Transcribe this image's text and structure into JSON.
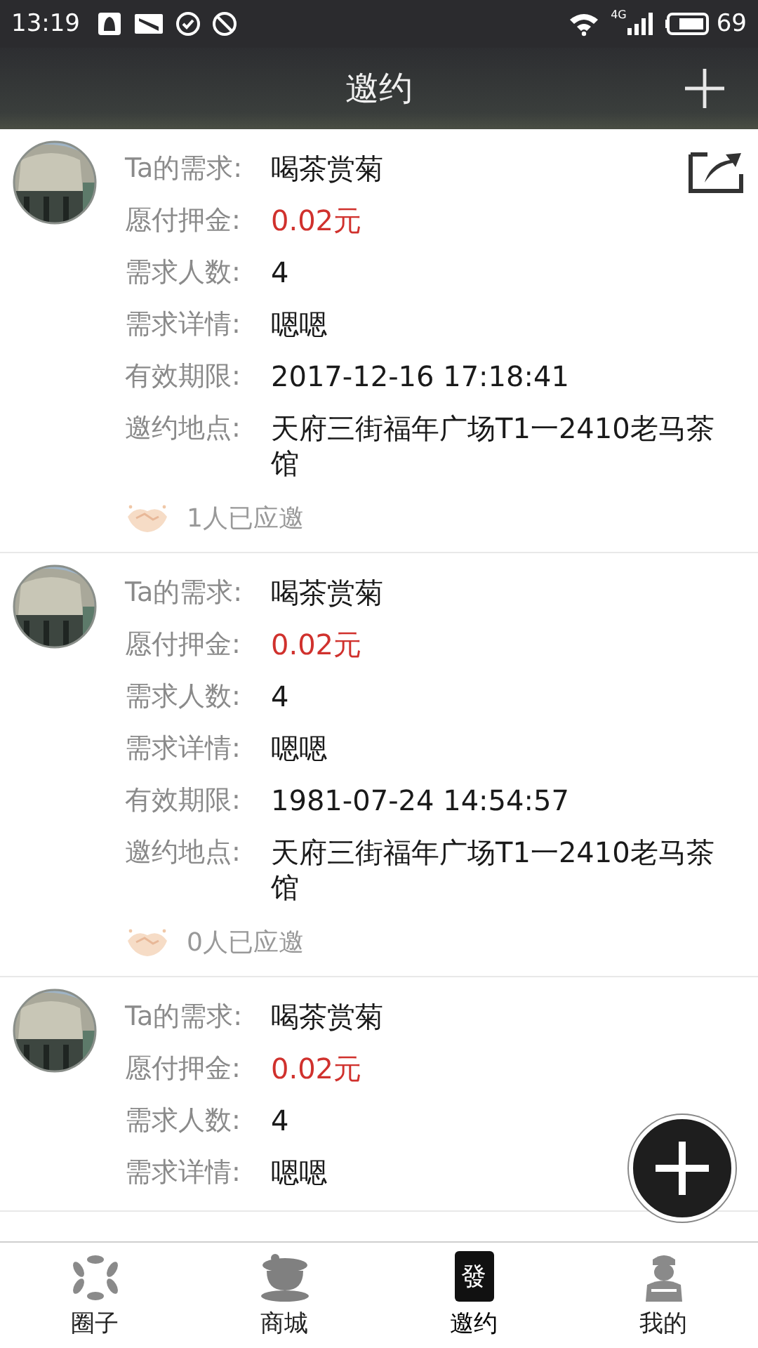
{
  "status_bar": {
    "time": "13:19",
    "network": "4G",
    "battery": "69"
  },
  "header": {
    "title": "邀约"
  },
  "invitations": [
    {
      "fields": [
        {
          "label": "Ta的需求:",
          "value": "喝茶赏菊",
          "kind": "text"
        },
        {
          "label": "愿付押金:",
          "value": "0.02元",
          "kind": "price"
        },
        {
          "label": "需求人数:",
          "value": "4",
          "kind": "text"
        },
        {
          "label": "需求详情:",
          "value": "嗯嗯",
          "kind": "text"
        },
        {
          "label": "有效期限:",
          "value": "2017-12-16 17:18:41",
          "kind": "text"
        },
        {
          "label": "邀约地点:",
          "value": "天府三街福年广场T1一2410老马茶馆",
          "kind": "text"
        }
      ],
      "responses": "1人已应邀",
      "shareable": true
    },
    {
      "fields": [
        {
          "label": "Ta的需求:",
          "value": "喝茶赏菊",
          "kind": "text"
        },
        {
          "label": "愿付押金:",
          "value": "0.02元",
          "kind": "price"
        },
        {
          "label": "需求人数:",
          "value": "4",
          "kind": "text"
        },
        {
          "label": "需求详情:",
          "value": "嗯嗯",
          "kind": "text"
        },
        {
          "label": "有效期限:",
          "value": "1981-07-24 14:54:57",
          "kind": "text"
        },
        {
          "label": "邀约地点:",
          "value": "天府三街福年广场T1一2410老马茶馆",
          "kind": "text"
        }
      ],
      "responses": "0人已应邀",
      "shareable": false
    },
    {
      "fields": [
        {
          "label": "Ta的需求:",
          "value": "喝茶赏菊",
          "kind": "text"
        },
        {
          "label": "愿付押金:",
          "value": "0.02元",
          "kind": "price"
        },
        {
          "label": "需求人数:",
          "value": "4",
          "kind": "text"
        },
        {
          "label": "需求详情:",
          "value": "嗯嗯",
          "kind": "text"
        }
      ],
      "shareable": false
    }
  ],
  "tabs": [
    {
      "label": "圈子",
      "kind": "circle",
      "selected": false
    },
    {
      "label": "商城",
      "kind": "shop",
      "selected": false
    },
    {
      "label": "邀约",
      "kind": "tile",
      "glyph": "發",
      "selected": true
    },
    {
      "label": "我的",
      "kind": "person",
      "selected": false
    }
  ]
}
